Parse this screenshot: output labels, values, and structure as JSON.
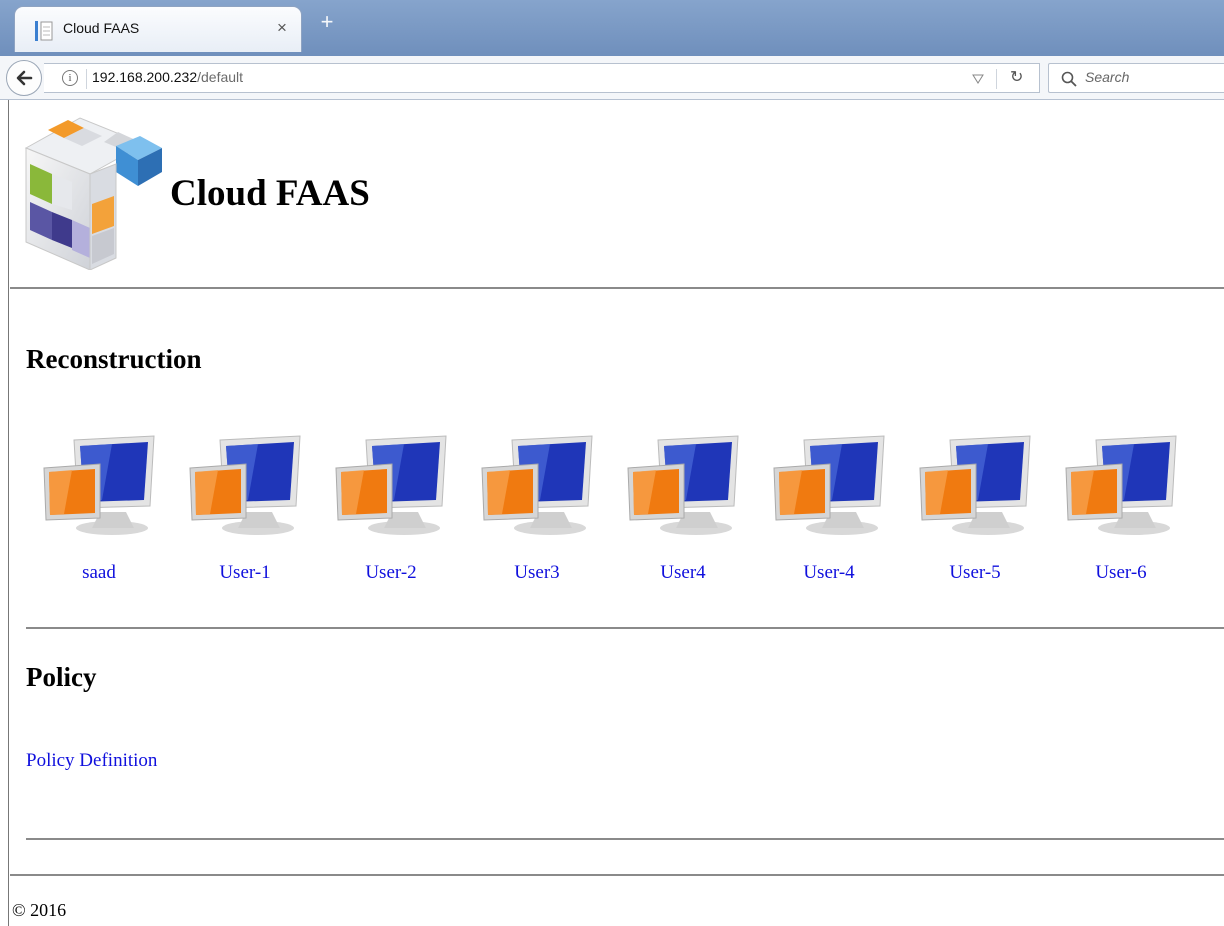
{
  "browser": {
    "tab_title": "Cloud FAAS",
    "tab_close": "×",
    "new_tab": "+",
    "url_host": "192.168.200.232",
    "url_path": "/default",
    "search_placeholder": "Search"
  },
  "header": {
    "title": "Cloud FAAS"
  },
  "reconstruction": {
    "heading": "Reconstruction",
    "users": [
      {
        "name": "saad"
      },
      {
        "name": "User-1"
      },
      {
        "name": "User-2"
      },
      {
        "name": "User3"
      },
      {
        "name": "User4"
      },
      {
        "name": "User-4"
      },
      {
        "name": "User-5"
      },
      {
        "name": "User-6"
      }
    ]
  },
  "policy": {
    "heading": "Policy",
    "link": "Policy Definition"
  },
  "footer": {
    "copyright": "© 2016"
  },
  "colors": {
    "link": "#1010dd",
    "monitor_orange": "#f07a10",
    "monitor_blue": "#1f36b8"
  }
}
